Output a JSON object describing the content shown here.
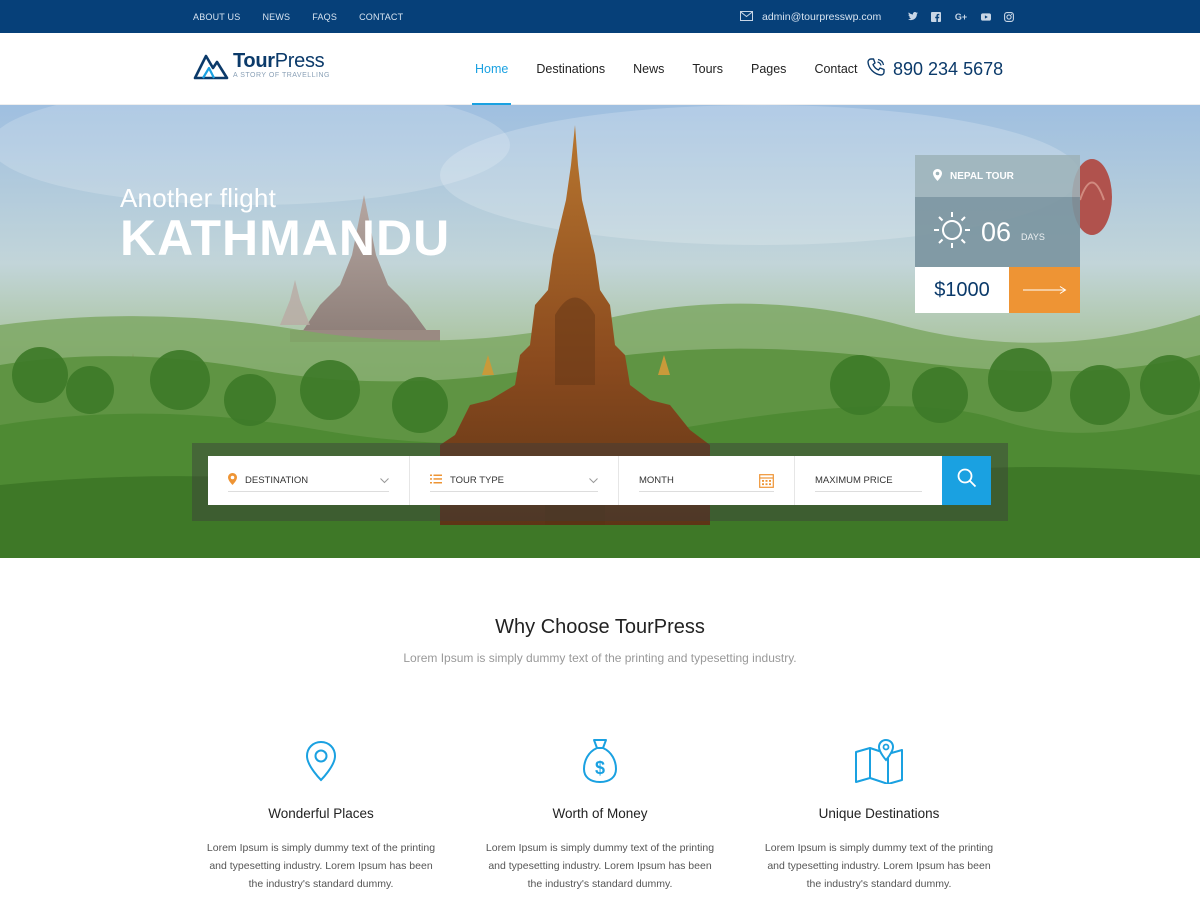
{
  "topbar": {
    "links": [
      "ABOUT US",
      "NEWS",
      "FAQS",
      "CONTACT"
    ],
    "email": "admin@tourpresswp.com",
    "social": [
      "twitter-icon",
      "facebook-icon",
      "google-plus-icon",
      "youtube-icon",
      "instagram-icon"
    ]
  },
  "header": {
    "logo_name_bold": "Tour",
    "logo_name_light": "Press",
    "logo_tagline": "A STORY OF TRAVELLING",
    "nav": [
      "Home",
      "Destinations",
      "News",
      "Tours",
      "Pages",
      "Contact"
    ],
    "active_nav": "Home",
    "phone": "890 234 5678"
  },
  "hero": {
    "subtitle": "Another flight",
    "title": "KATHMANDU",
    "tour_card": {
      "label": "NEPAL TOUR",
      "days_number": "06",
      "days_unit": "DAYS",
      "price": "$1000"
    },
    "search": {
      "destination": "DESTINATION",
      "tour_type": "TOUR TYPE",
      "month": "MONTH",
      "max_price": "MAXIMUM PRICE"
    }
  },
  "why": {
    "title": "Why Choose TourPress",
    "subtitle": "Lorem Ipsum is simply dummy text of the printing and typesetting industry.",
    "features": [
      {
        "icon": "map-pin-icon",
        "title": "Wonderful Places",
        "text_lines": [
          "Lorem Ipsum is simply dummy text of the printing",
          "and typesetting industry. Lorem Ipsum has been",
          "the industry's standard dummy."
        ]
      },
      {
        "icon": "money-bag-icon",
        "title": "Worth of Money",
        "text_lines": [
          "Lorem Ipsum is simply dummy text of the printing",
          "and typesetting industry. Lorem Ipsum has been",
          "the industry's standard dummy."
        ]
      },
      {
        "icon": "map-icon",
        "title": "Unique Destinations",
        "text_lines": [
          "Lorem Ipsum is simply dummy text of the printing",
          "and typesetting industry. Lorem Ipsum has been",
          "the industry's standard dummy."
        ]
      }
    ]
  },
  "colors": {
    "topbar": "#064079",
    "accent": "#1aa1e1",
    "brand": "#0b3a6a",
    "cta": "#ee9434"
  }
}
